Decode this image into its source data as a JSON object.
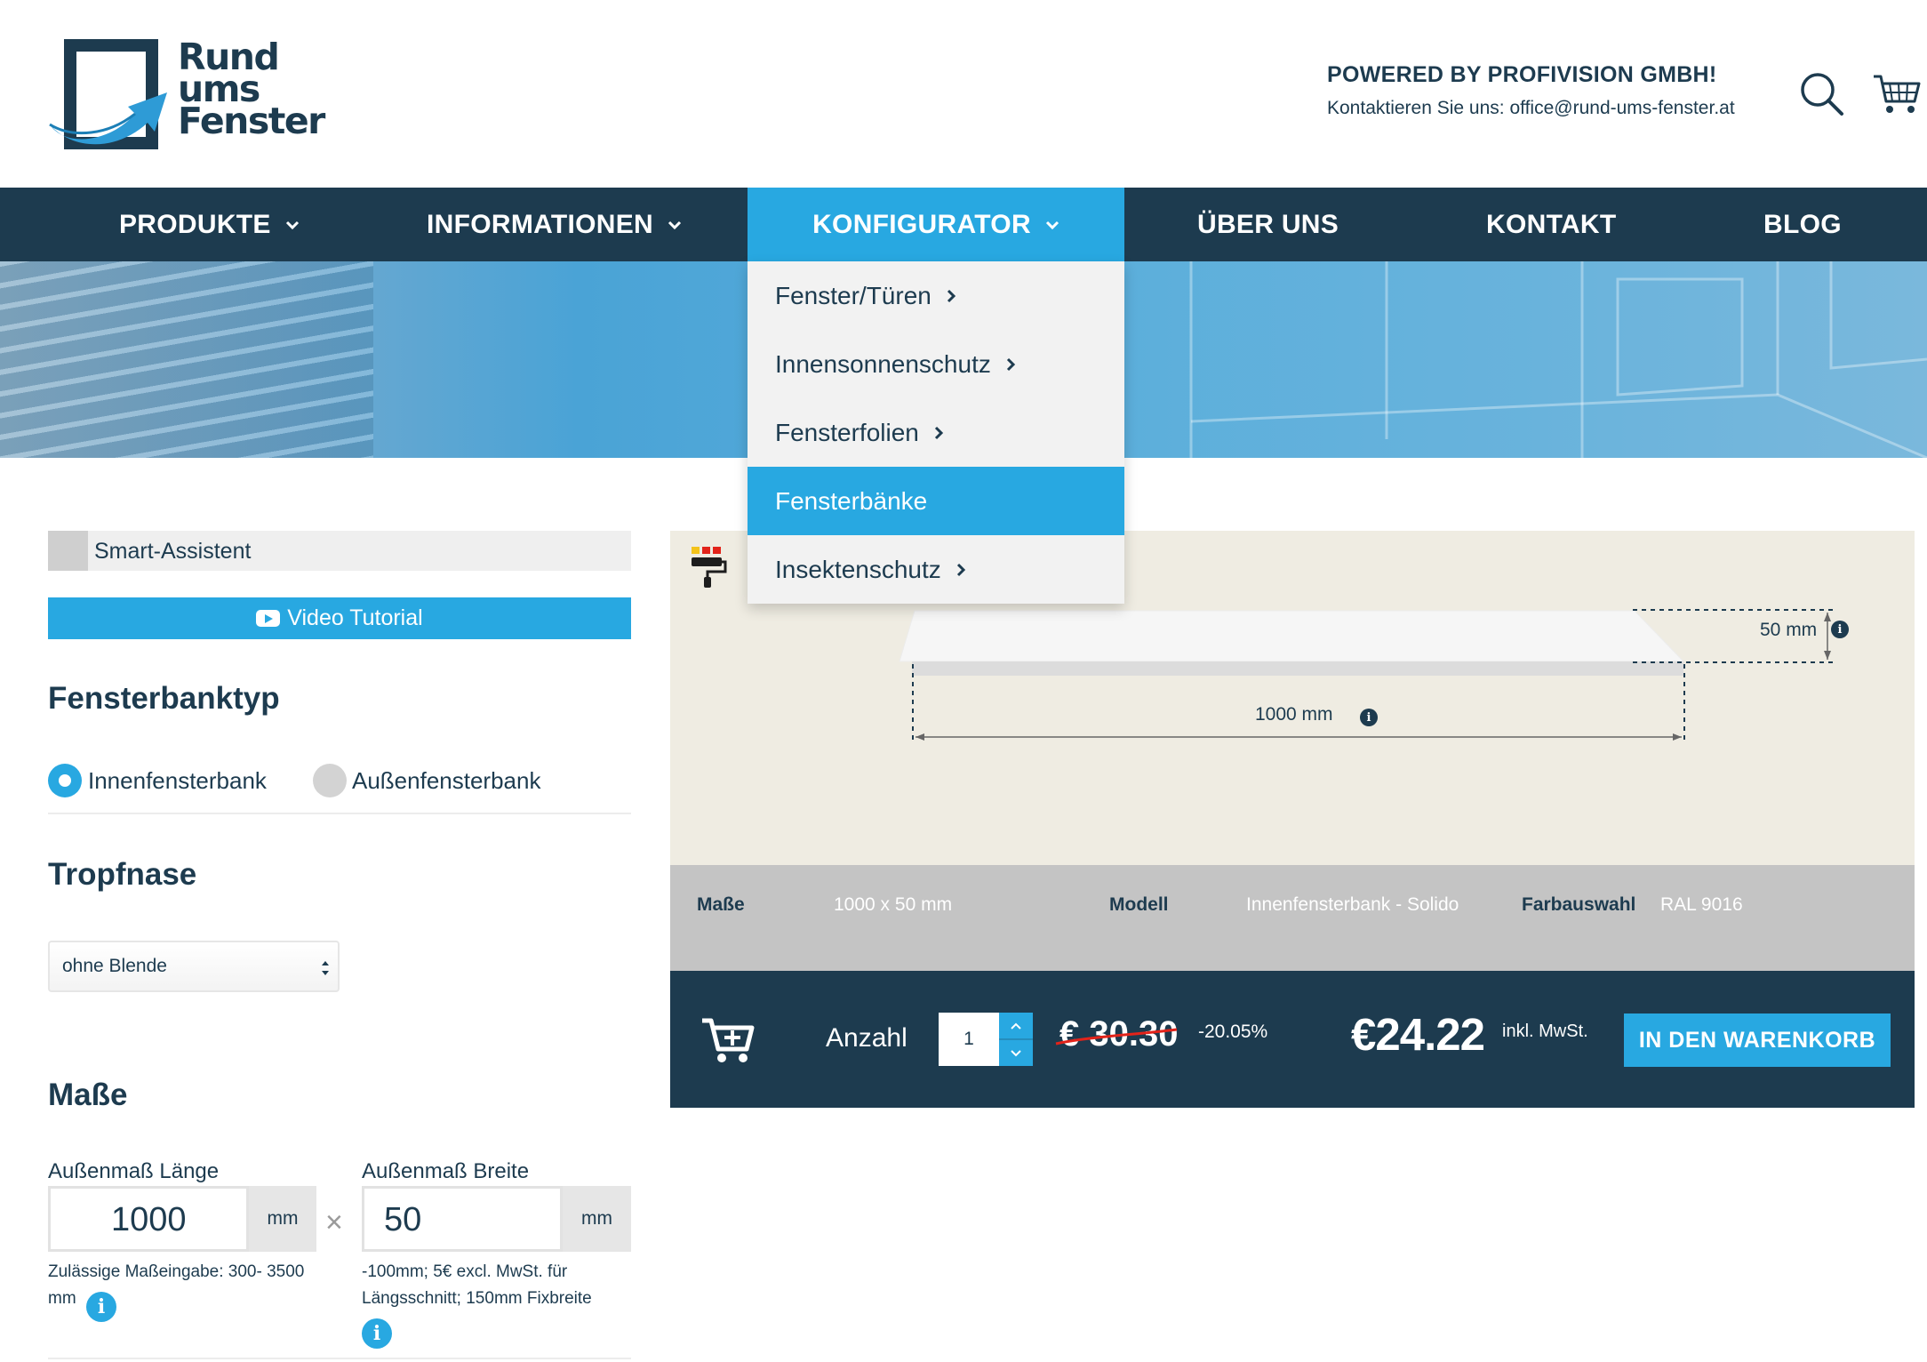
{
  "header": {
    "logo_lines": [
      "Rund",
      "ums",
      "Fenster"
    ],
    "powered_by": "POWERED BY PROFIVISION GMBH!",
    "contact": "Kontaktieren Sie uns: office@rund-ums-fenster.at",
    "icons": {
      "search": "search-icon",
      "cart": "cart-icon"
    }
  },
  "nav": {
    "items": [
      {
        "label": "PRODUKTE",
        "has_dropdown": true
      },
      {
        "label": "INFORMATIONEN",
        "has_dropdown": true
      },
      {
        "label": "KONFIGURATOR",
        "has_dropdown": true,
        "active": true
      },
      {
        "label": "ÜBER UNS",
        "has_dropdown": false
      },
      {
        "label": "KONTAKT",
        "has_dropdown": false
      },
      {
        "label": "BLOG",
        "has_dropdown": false
      }
    ]
  },
  "dropdown": {
    "items": [
      {
        "label": "Fenster/Türen",
        "has_submenu": true
      },
      {
        "label": "Innensonnenschutz",
        "has_submenu": true
      },
      {
        "label": "Fensterfolien",
        "has_submenu": true
      },
      {
        "label": "Fensterbänke",
        "has_submenu": false,
        "active": true
      },
      {
        "label": "Insektenschutz",
        "has_submenu": true
      }
    ]
  },
  "config": {
    "smart_assistant": "Smart-Assistent",
    "video_tutorial": "Video Tutorial",
    "type_heading": "Fensterbanktyp",
    "type_options": [
      {
        "label": "Innenfensterbank",
        "selected": true
      },
      {
        "label": "Außenfensterbank",
        "selected": false
      }
    ],
    "drip_heading": "Tropfnase",
    "drip_selected": "ohne Blende",
    "dims_heading": "Maße",
    "length": {
      "label": "Außenmaß Länge",
      "value": "1000",
      "unit": "mm",
      "hint_line1": "Zulässige Maßeingabe: 300- 3500",
      "hint_line2": "mm"
    },
    "times_symbol": "×",
    "width": {
      "label": "Außenmaß Breite",
      "value": "50",
      "unit": "mm",
      "hint_line1": "-100mm; 5€ excl. MwSt. für",
      "hint_line2": "Längsschnitt; 150mm Fixbreite"
    },
    "info_symbol": "i"
  },
  "preview": {
    "width_label": "1000 mm",
    "depth_label": "50 mm",
    "icon": "paint-roller-icon"
  },
  "summary": {
    "dims_key": "Maße",
    "dims_value": "1000 x 50 mm",
    "model_key": "Modell",
    "model_value": "Innenfensterbank - Solido",
    "color_key": "Farbauswahl",
    "color_value": "RAL 9016"
  },
  "purchase": {
    "qty_label": "Anzahl",
    "qty_value": "1",
    "old_price": "€ 30.30",
    "discount": "-20.05%",
    "new_price": "€24.22",
    "vat_note": "inkl. MwSt.",
    "add_to_cart": "IN DEN WARENKORB"
  },
  "colors": {
    "primary_dark": "#1d3b4f",
    "accent_blue": "#28a8e1",
    "preview_bg": "#efece2",
    "summary_bg": "#c4c4c4",
    "strike_red": "#e2231a"
  }
}
